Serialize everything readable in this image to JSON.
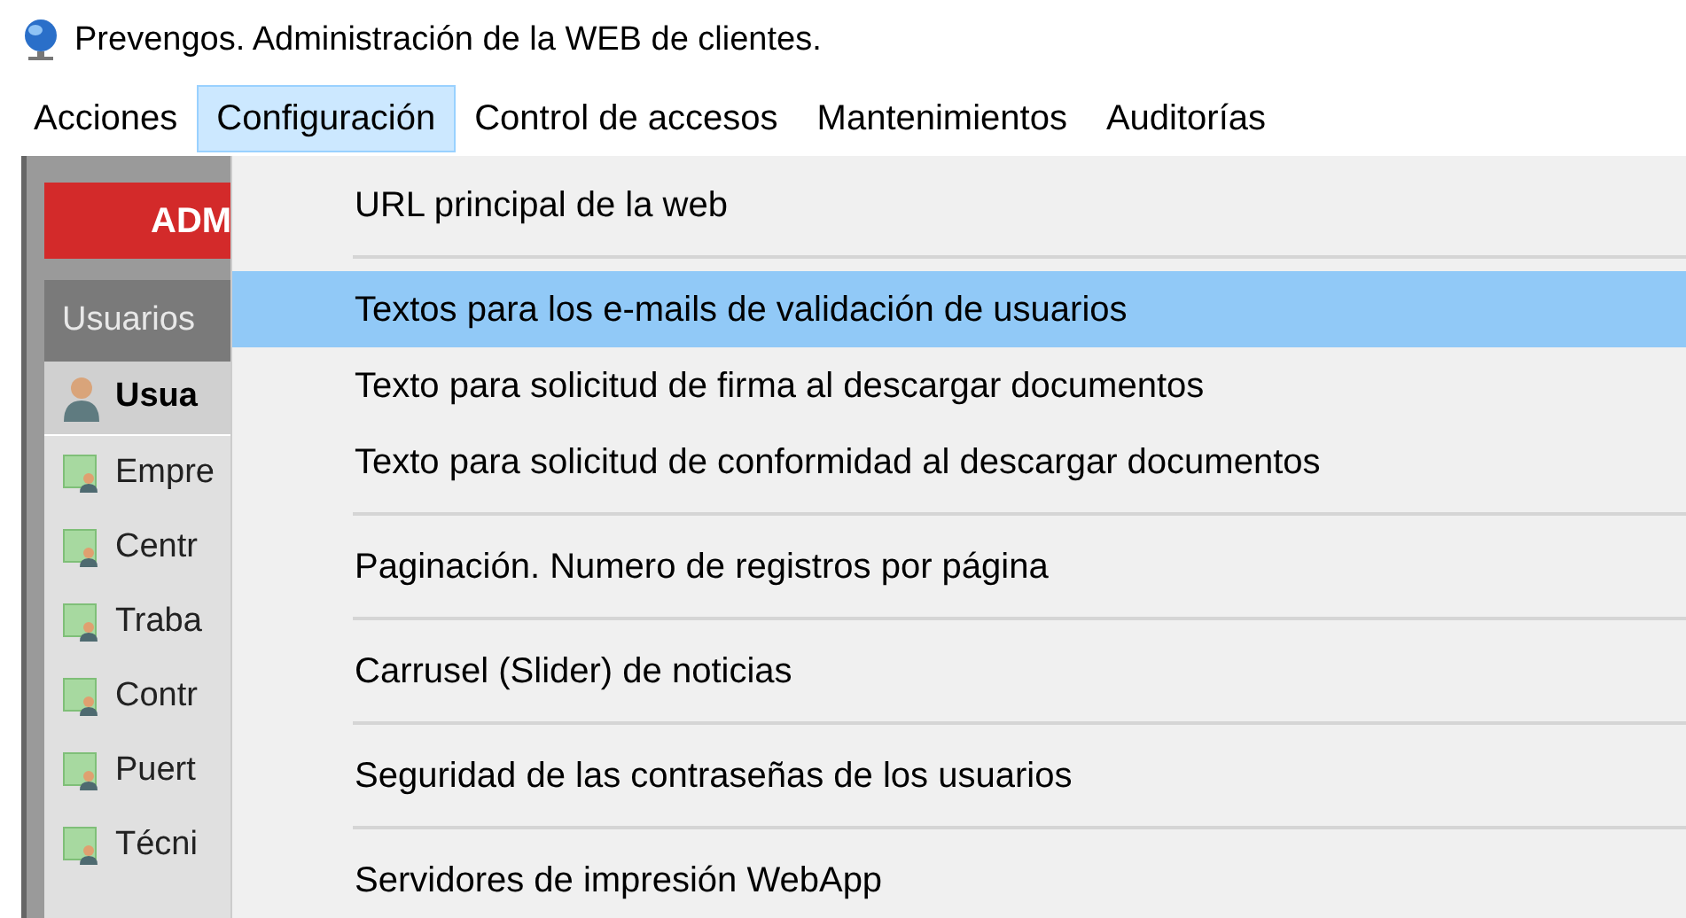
{
  "window": {
    "title": "Prevengos. Administración de la WEB de clientes."
  },
  "menu_bar": [
    {
      "label": "Acciones",
      "selected": false
    },
    {
      "label": "Configuración",
      "selected": true
    },
    {
      "label": "Control de accesos",
      "selected": false
    },
    {
      "label": "Mantenimientos",
      "selected": false
    },
    {
      "label": "Auditorías",
      "selected": false
    }
  ],
  "sidebar": {
    "header": "ADM",
    "section": "Usuarios",
    "items": [
      {
        "label": "Usua",
        "selected": true
      },
      {
        "label": "Empre",
        "selected": false
      },
      {
        "label": "Centr",
        "selected": false
      },
      {
        "label": "Traba",
        "selected": false
      },
      {
        "label": "Contr",
        "selected": false
      },
      {
        "label": "Puert",
        "selected": false
      },
      {
        "label": "Técni",
        "selected": false
      }
    ]
  },
  "dropdown": {
    "items": [
      {
        "label": "URL principal de la web",
        "selected": false,
        "separator_after": true
      },
      {
        "label": "Textos para los e-mails de validación de usuarios",
        "selected": true,
        "separator_after": false
      },
      {
        "label": "Texto para solicitud de firma al descargar documentos",
        "selected": false,
        "separator_after": false
      },
      {
        "label": "Texto para solicitud de conformidad al descargar documentos",
        "selected": false,
        "separator_after": true
      },
      {
        "label": "Paginación. Numero de registros por página",
        "selected": false,
        "separator_after": true
      },
      {
        "label": "Carrusel (Slider) de noticias",
        "selected": false,
        "separator_after": true
      },
      {
        "label": "Seguridad de las contraseñas de los usuarios",
        "selected": false,
        "separator_after": true
      },
      {
        "label": "Servidores de impresión WebApp",
        "selected": false,
        "separator_after": false
      }
    ]
  }
}
